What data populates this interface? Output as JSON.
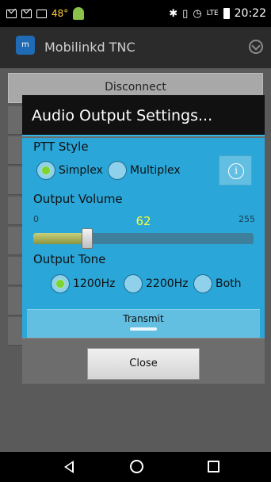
{
  "status_bar": {
    "temperature": "48°",
    "time": "20:22",
    "network": "LTE"
  },
  "app": {
    "title": "Mobilinkd TNC",
    "logo": "m"
  },
  "background": {
    "disconnect_label": "Disconnect"
  },
  "dialog": {
    "title": "Audio Output Settings...",
    "ptt": {
      "label": "PTT Style",
      "options": [
        "Simplex",
        "Multiplex"
      ],
      "selected": "Simplex",
      "info_glyph": "i"
    },
    "volume": {
      "label": "Output Volume",
      "min": 0,
      "max": 255,
      "value": 62
    },
    "tone": {
      "label": "Output Tone",
      "options": [
        "1200Hz",
        "2200Hz",
        "Both"
      ],
      "selected": "1200Hz"
    },
    "transmit_label": "Transmit",
    "close_label": "Close"
  },
  "colors": {
    "dialog_body": "#2aa6d8",
    "value_text": "#ffff33",
    "radio_selected": "#7dd42e",
    "header_rule": "#33b5e5"
  }
}
